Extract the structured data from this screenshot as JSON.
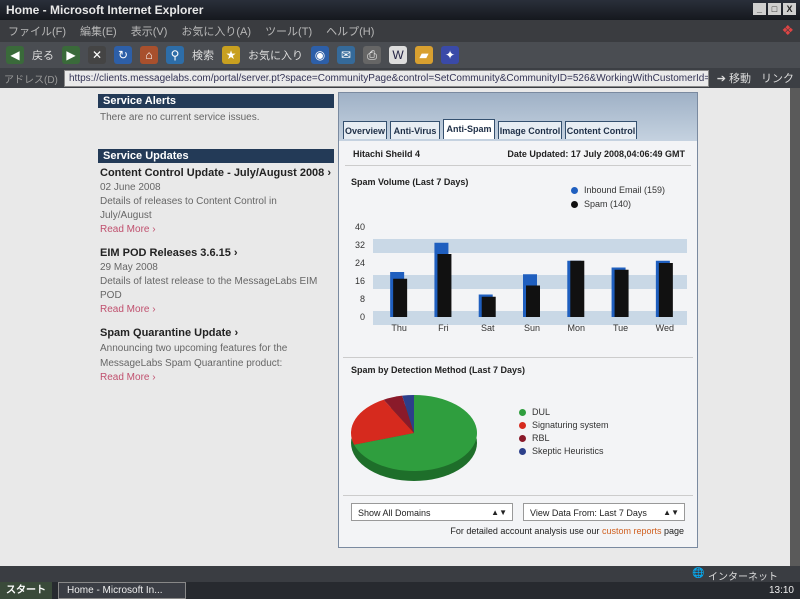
{
  "window": {
    "title": "Home - Microsoft Internet Explorer",
    "win_buttons": [
      "_",
      "□",
      "X"
    ]
  },
  "menu": [
    "ファイル(F)",
    "編集(E)",
    "表示(V)",
    "お気に入り(A)",
    "ツール(T)",
    "ヘルプ(H)"
  ],
  "toolbar": {
    "back": "戻る",
    "search": "検索",
    "favorites": "お気に入り"
  },
  "address": {
    "label": "アドレス(D)",
    "url": "https://clients.messagelabs.com/portal/server.pt?space=CommunityPage&control=SetCommunity&CommunityID=526&WorkingWithCustomerId=43724&Working",
    "go": "移動",
    "links": "リンク"
  },
  "alerts": {
    "title": "Service Alerts",
    "text": "There are no current service issues."
  },
  "updates": {
    "title": "Service Updates",
    "items": [
      {
        "title": "Content Control Update - July/August 2008 ›",
        "date": "02 June 2008",
        "desc1": "Details of releases to Content Control in",
        "desc2": "July/August",
        "more": "Read More ›"
      },
      {
        "title": "EIM POD Releases 3.6.15 ›",
        "date": "29 May 2008",
        "desc1": "Details of latest release to the MessageLabs EIM",
        "desc2": "POD",
        "more": "Read More ›"
      },
      {
        "title": "Spam Quarantine Update ›",
        "date": "",
        "desc1": "Announcing two upcoming features for the",
        "desc2": "MessageLabs Spam Quarantine product:",
        "more": "Read More ›"
      }
    ]
  },
  "tabs": [
    "Overview",
    "Anti-Virus",
    "Anti-Spam",
    "Image Control",
    "Content Control"
  ],
  "active_tab": "Anti-Spam",
  "panel": {
    "account": "Hitachi Sheild 4",
    "date_updated": "Date Updated: 17 July 2008,04:06:49 GMT"
  },
  "chart_data": [
    {
      "type": "bar",
      "title": "Spam Volume (Last 7 Days)",
      "categories": [
        "Thu",
        "Fri",
        "Sat",
        "Sun",
        "Mon",
        "Tue",
        "Wed"
      ],
      "series": [
        {
          "name": "Inbound Email (159)",
          "color": "#1f5fbf",
          "values": [
            20,
            33,
            10,
            19,
            25,
            22,
            25
          ]
        },
        {
          "name": "Spam (140)",
          "color": "#111111",
          "values": [
            17,
            28,
            9,
            14,
            25,
            21,
            24
          ]
        }
      ],
      "yticks": [
        "40",
        "32",
        "24",
        "16",
        "8",
        "0"
      ],
      "ylim": [
        0,
        40
      ]
    },
    {
      "type": "pie",
      "title": "Spam by Detection Method  (Last 7 Days)",
      "labels": [
        "DUL",
        "Signaturing system",
        "RBL",
        "Skeptic Heuristics"
      ],
      "values": [
        70,
        22,
        5,
        3
      ],
      "colors": [
        "#2f9e3e",
        "#d62a1e",
        "#8a1a2a",
        "#2c3f8a"
      ]
    }
  ],
  "selects": {
    "domains": "Show All Domains",
    "range": "View Data From: Last 7 Days"
  },
  "footer": {
    "pre": "For detailed account analysis use our ",
    "link": "custom reports",
    "post": " page"
  },
  "status": {
    "zone": "インターネット"
  },
  "taskbar": {
    "start": "スタート",
    "task": "Home - Microsoft In...",
    "clock": "13:10"
  }
}
